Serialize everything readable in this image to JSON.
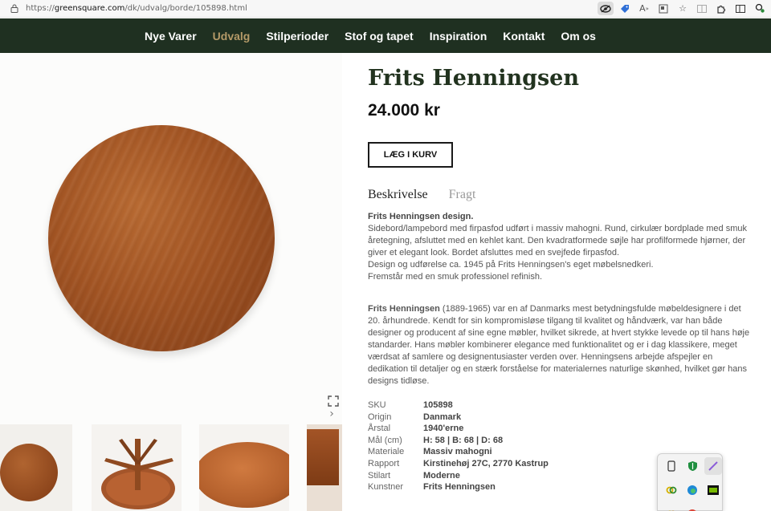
{
  "browser": {
    "url_prefix": "https://",
    "url_host": "greensquare.com",
    "url_path": "/dk/udvalg/borde/105898.html"
  },
  "nav": {
    "items": [
      "Nye Varer",
      "Udvalg",
      "Stilperioder",
      "Stof og tapet",
      "Inspiration",
      "Kontakt",
      "Om os"
    ],
    "active": "Udvalg"
  },
  "product": {
    "title": "Frits Henningsen",
    "price": "24.000 kr",
    "add_to_cart": "LÆG I KURV",
    "tabs": [
      "Beskrivelse",
      "Fragt"
    ],
    "desc_heading": "Frits Henningsen design.",
    "desc_lines": [
      "Sidebord/lampebord med firpasfod udført i massiv mahogni. Rund, cirkulær bordplade med smuk åretegning, afsluttet med en kehlet kant. Den kvadratformede søjle har profilformede hjørner, der giver et elegant look. Bordet afsluttes med en svejfede firpasfod.",
      "Design og udførelse ca. 1945 på Frits Henningsen's eget møbelsnedkeri.",
      "Fremstår med en smuk professionel refinish."
    ],
    "bio_name": "Frits Henningsen",
    "bio_text": " (1889-1965) var en af Danmarks mest betydningsfulde møbeldesignere i det 20. århundrede. Kendt for sin kompromisløse tilgang til kvalitet og håndværk, var han både designer og producent af sine egne møbler, hvilket sikrede, at hvert stykke levede op til hans høje standarder. Hans møbler kombinerer elegance med funktionalitet og er i dag klassikere, meget værdsat af samlere og designentusiaster verden over. Henningsens arbejde afspejler en dedikation til detaljer og en stærk forståelse for materialernes naturlige skønhed, hvilket gør hans designs tidløse.",
    "specs": [
      {
        "key": "SKU",
        "value": "105898"
      },
      {
        "key": "Origin",
        "value": "Danmark"
      },
      {
        "key": "Årstal",
        "value": "1940'erne"
      },
      {
        "key": "Mål (cm)",
        "value": "H: 58 | B: 68 | D: 68"
      },
      {
        "key": "Materiale",
        "value": "Massiv mahogni"
      },
      {
        "key": "Rapport",
        "value": "Kirstinehøj 27C, 2770 Kastrup"
      },
      {
        "key": "Stilart",
        "value": "Moderne"
      },
      {
        "key": "Kunstner",
        "value": "Frits Henningsen"
      }
    ]
  },
  "colors": {
    "nav_bg": "#1f3021",
    "nav_active": "#b49a68",
    "wood": "#9a4e22"
  },
  "icons": {
    "tray": [
      "phone-icon",
      "shield-icon",
      "pen-icon",
      "link-icon",
      "edge-icon",
      "nvidia-icon",
      "link-icon",
      "chrome-icon"
    ]
  }
}
